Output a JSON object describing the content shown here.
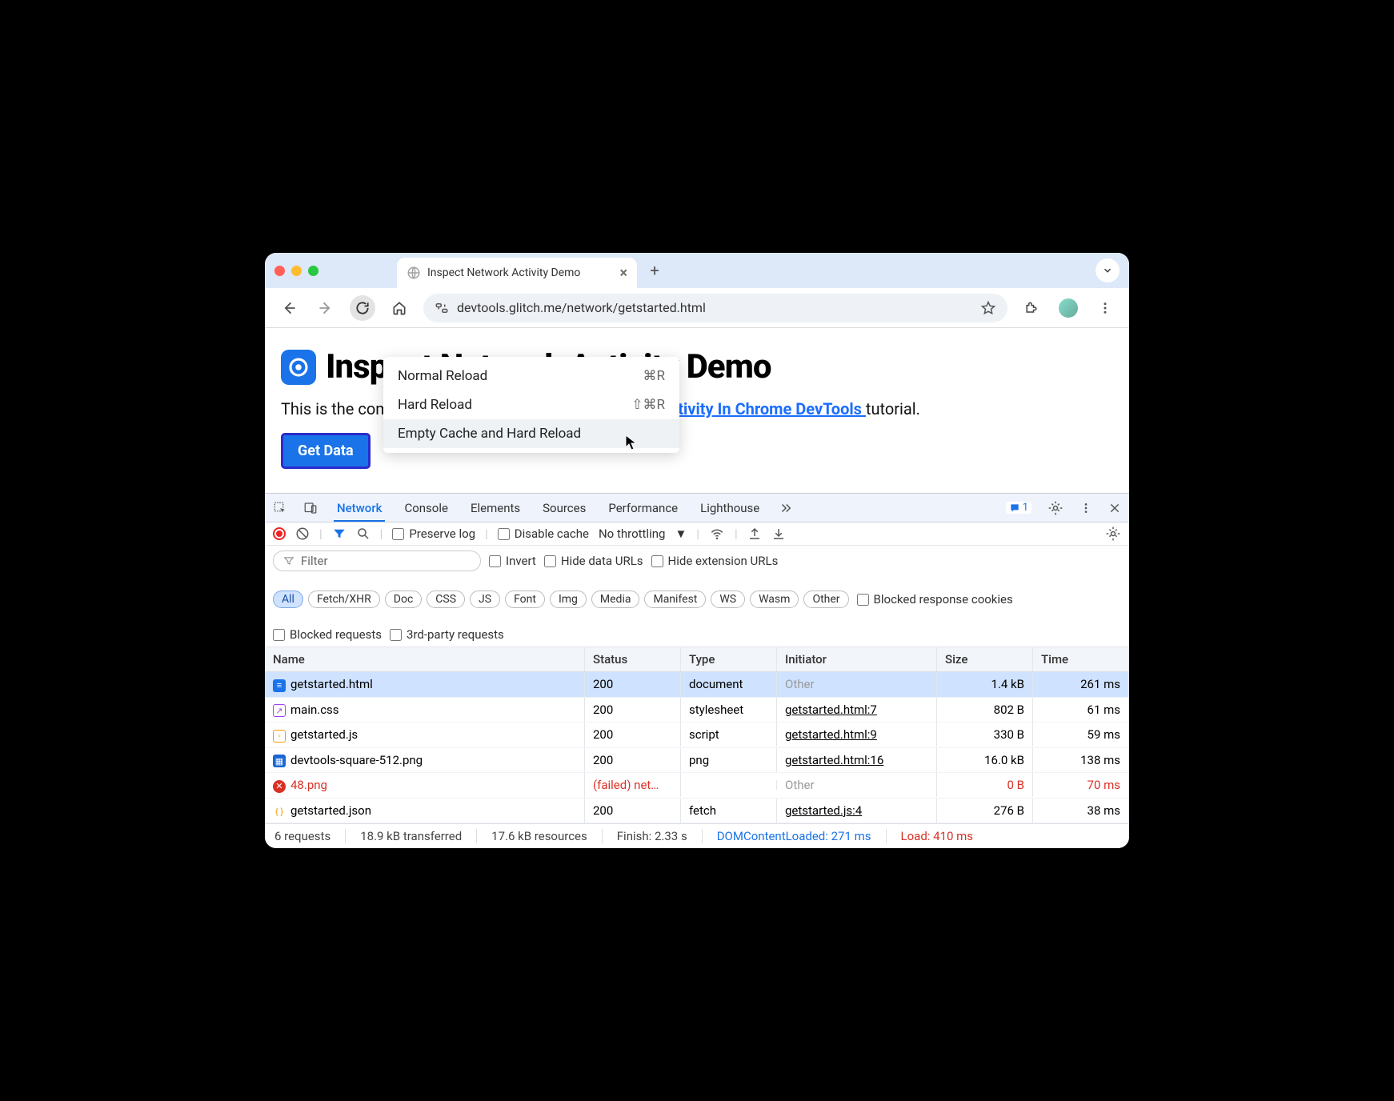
{
  "browser": {
    "tab_title": "Inspect Network Activity Demo",
    "url": "devtools.glitch.me/network/getstarted.html"
  },
  "context_menu": {
    "items": [
      {
        "label": "Normal Reload",
        "shortcut": "⌘R"
      },
      {
        "label": "Hard Reload",
        "shortcut": "⇧⌘R"
      },
      {
        "label": "Empty Cache and Hard Reload",
        "shortcut": ""
      }
    ]
  },
  "page": {
    "heading": "Inspect Network Activity Demo",
    "desc_pre": "This is the companion demo for the ",
    "desc_link": "Inspect Network Activity In Chrome DevTools ",
    "desc_post": "tutorial.",
    "button": "Get Data"
  },
  "devtools": {
    "tabs": [
      "Network",
      "Console",
      "Elements",
      "Sources",
      "Performance",
      "Lighthouse"
    ],
    "active_tab": "Network",
    "badge_count": "1",
    "subbar": {
      "preserve_log": "Preserve log",
      "disable_cache": "Disable cache",
      "throttling": "No throttling"
    },
    "filter_placeholder": "Filter",
    "filter_opts": {
      "invert": "Invert",
      "hide_data": "Hide data URLs",
      "hide_ext": "Hide extension URLs",
      "blocked_cookies": "Blocked response cookies",
      "blocked_requests": "Blocked requests",
      "third_party": "3rd-party requests"
    },
    "chips": [
      "All",
      "Fetch/XHR",
      "Doc",
      "CSS",
      "JS",
      "Font",
      "Img",
      "Media",
      "Manifest",
      "WS",
      "Wasm",
      "Other"
    ],
    "columns": [
      "Name",
      "Status",
      "Type",
      "Initiator",
      "Size",
      "Time"
    ],
    "rows": [
      {
        "name": "getstarted.html",
        "status": "200",
        "type": "document",
        "initiator": "Other",
        "size": "1.4 kB",
        "time": "261 ms",
        "icon": "doc",
        "selected": true,
        "init_grey": true
      },
      {
        "name": "main.css",
        "status": "200",
        "type": "stylesheet",
        "initiator": "getstarted.html:7",
        "size": "802 B",
        "time": "61 ms",
        "icon": "css"
      },
      {
        "name": "getstarted.js",
        "status": "200",
        "type": "script",
        "initiator": "getstarted.html:9",
        "size": "330 B",
        "time": "59 ms",
        "icon": "js"
      },
      {
        "name": "devtools-square-512.png",
        "status": "200",
        "type": "png",
        "initiator": "getstarted.html:16",
        "size": "16.0 kB",
        "time": "138 ms",
        "icon": "img"
      },
      {
        "name": "48.png",
        "status": "(failed) net…",
        "type": "",
        "initiator": "Other",
        "size": "0 B",
        "time": "70 ms",
        "icon": "err",
        "failed": true,
        "init_grey": true
      },
      {
        "name": "getstarted.json",
        "status": "200",
        "type": "fetch",
        "initiator": "getstarted.js:4",
        "size": "276 B",
        "time": "38 ms",
        "icon": "fetch"
      }
    ],
    "status": {
      "requests": "6 requests",
      "transferred": "18.9 kB transferred",
      "resources": "17.6 kB resources",
      "finish": "Finish: 2.33 s",
      "dcl": "DOMContentLoaded: 271 ms",
      "load": "Load: 410 ms"
    }
  }
}
